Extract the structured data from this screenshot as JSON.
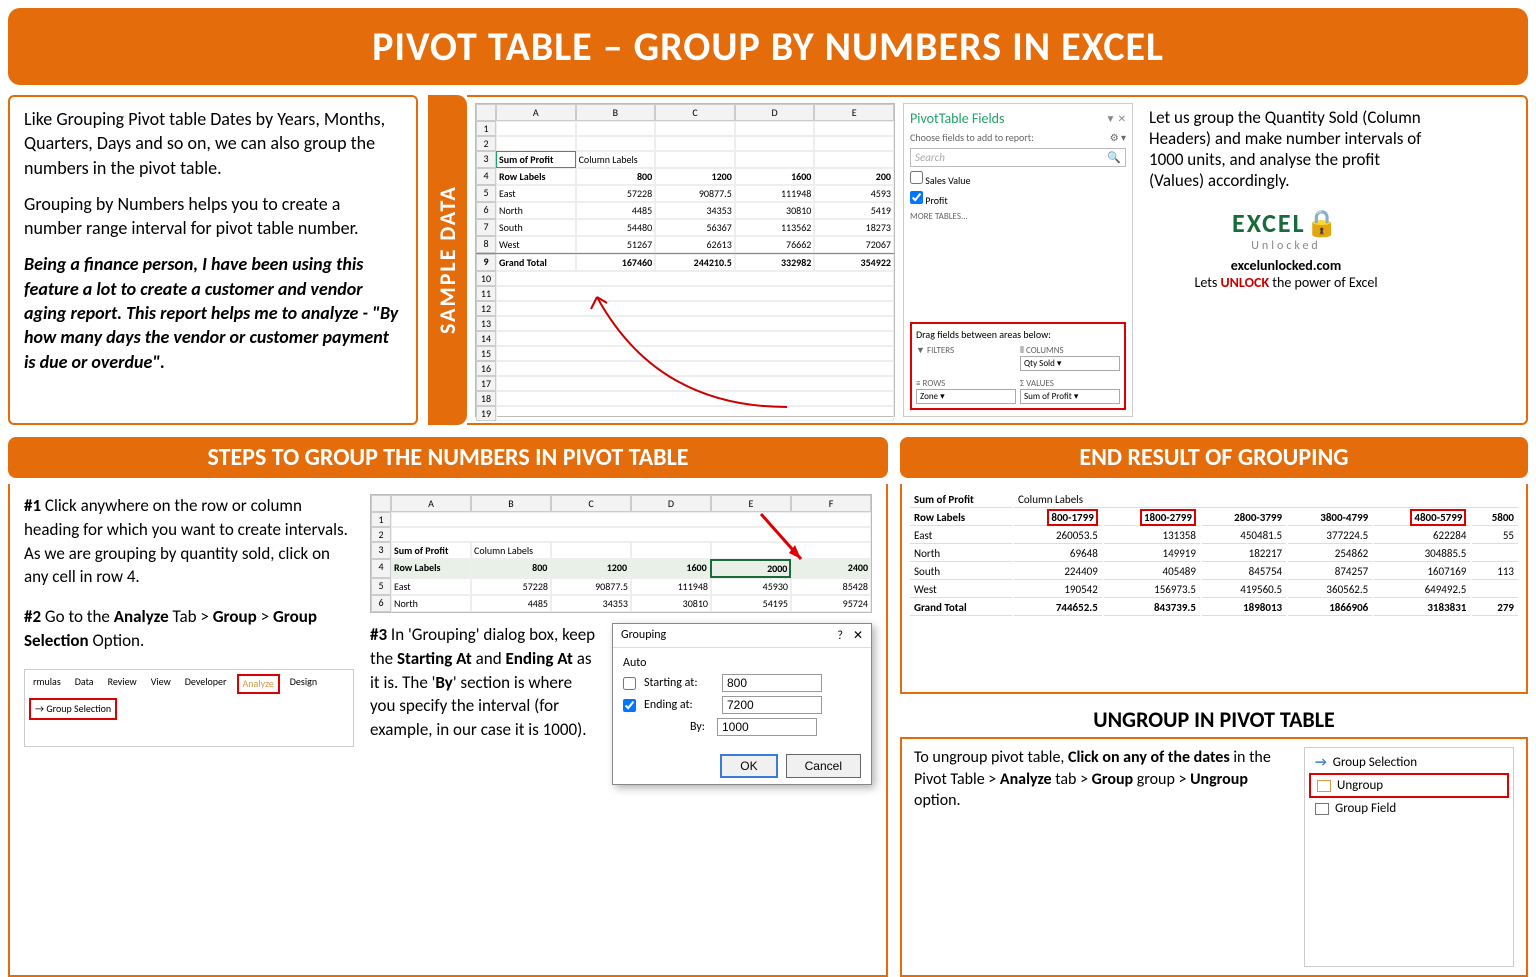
{
  "title": "PIVOT TABLE – GROUP BY NUMBERS IN EXCEL",
  "intro": {
    "p1": "Like Grouping Pivot table Dates by Years, Months, Quarters, Days and so on, we can also group the numbers in the pivot table.",
    "p2": "Grouping by Numbers helps you to create a number range interval for pivot table number.",
    "p3": "Being a finance person, I have been using this feature a lot to create a customer and vendor aging report. This report helps me to analyze - \"By how many days the vendor or customer payment is due or overdue\"."
  },
  "sample_label": "SAMPLE DATA",
  "goal": {
    "text": "Let us group the Quantity Sold (Column Headers) and make number intervals of 1000 units, and analyse the profit (Values) accordingly.",
    "logo_main": "EXCEL",
    "logo_sub": "Unlocked",
    "site": "excelunlocked.com",
    "tag_pre": "Lets ",
    "tag_unlock": "UNLOCK",
    "tag_post": " the power of Excel"
  },
  "ptfields": {
    "title": "PivotTable Fields",
    "subtitle": "Choose fields to add to report:",
    "search": "Search",
    "f1": "Sales Value",
    "f2": "Profit",
    "more": "MORE TABLES...",
    "drag": "Drag fields between areas below:",
    "filters_label": "FILTERS",
    "columns_label": "COLUMNS",
    "columns_field": "Qty Sold",
    "rows_label": "ROWS",
    "rows_field": "Zone",
    "values_label": "VALUES",
    "values_field": "Sum of Profit"
  },
  "sample_grid": {
    "cols": [
      "A",
      "B",
      "C",
      "D",
      "E"
    ],
    "corner": "Sum of Profit",
    "collabel": "Column Labels",
    "rowlabel": "Row Labels",
    "headers": [
      "800",
      "1200",
      "1600",
      "200"
    ],
    "rows": [
      {
        "label": "East",
        "v": [
          "57228",
          "90877.5",
          "111948",
          "4593"
        ]
      },
      {
        "label": "North",
        "v": [
          "4485",
          "34353",
          "30810",
          "5419"
        ]
      },
      {
        "label": "South",
        "v": [
          "54480",
          "56367",
          "113562",
          "18273"
        ]
      },
      {
        "label": "West",
        "v": [
          "51267",
          "62613",
          "76662",
          "72067"
        ]
      },
      {
        "label": "Grand Total",
        "v": [
          "167460",
          "244210.5",
          "332982",
          "354922"
        ]
      }
    ]
  },
  "steps_header": "STEPS TO GROUP THE NUMBERS IN PIVOT TABLE",
  "step1": {
    "num": "#1",
    "text": " Click anywhere on the row or column heading for which you want to create intervals. As we are grouping by quantity sold, click on any cell in row 4."
  },
  "step2": {
    "num": "#2",
    "pre": " Go to the ",
    "analyze": "Analyze",
    "mid": " Tab > ",
    "group": "Group",
    "mid2": " > ",
    "gs": "Group Selection",
    "post": " Option."
  },
  "step3": {
    "num": "#3",
    "pre": " In 'Grouping' dialog box, keep the ",
    "sa": "Starting At",
    "mid": " and ",
    "ea": "Ending At",
    "mid2": " as it is. The '",
    "by": "By",
    "post": "' section is where you specify the interval (for example, in our case it is 1000)."
  },
  "mini_grid": {
    "cols": [
      "A",
      "B",
      "C",
      "D",
      "E",
      "F"
    ],
    "corner": "Sum of Profit",
    "collabel": "Column Labels",
    "rowlabel": "Row Labels",
    "headers": [
      "800",
      "1200",
      "1600",
      "2000",
      "2400"
    ],
    "rows": [
      {
        "label": "East",
        "v": [
          "57228",
          "90877.5",
          "111948",
          "45930",
          "85428"
        ]
      },
      {
        "label": "North",
        "v": [
          "4485",
          "34353",
          "30810",
          "54195",
          "95724"
        ]
      }
    ]
  },
  "ribbon": {
    "tabs": [
      "rmulas",
      "Data",
      "Review",
      "View",
      "Developer",
      "Analyze",
      "Design"
    ],
    "group_selection": "Group Selection"
  },
  "dialog": {
    "title": "Grouping",
    "help": "?",
    "close": "✕",
    "auto": "Auto",
    "starting_label": "Starting at:",
    "starting_val": "800",
    "ending_label": "Ending at:",
    "ending_val": "7200",
    "by_label": "By:",
    "by_val": "1000",
    "ok": "OK",
    "cancel": "Cancel"
  },
  "result_header": "END RESULT OF GROUPING",
  "result": {
    "corner": "Sum of Profit",
    "collabel": "Column Labels",
    "rowlabel": "Row Labels",
    "cols": [
      "800-1799",
      "1800-2799",
      "2800-3799",
      "3800-4799",
      "4800-5799",
      "5800"
    ],
    "rows": [
      {
        "label": "East",
        "v": [
          "260053.5",
          "131358",
          "450481.5",
          "377224.5",
          "622284",
          "55"
        ]
      },
      {
        "label": "North",
        "v": [
          "69648",
          "149919",
          "182217",
          "254862",
          "304885.5",
          ""
        ]
      },
      {
        "label": "South",
        "v": [
          "224409",
          "405489",
          "845754",
          "874257",
          "1607169",
          "113"
        ]
      },
      {
        "label": "West",
        "v": [
          "190542",
          "156973.5",
          "419560.5",
          "360562.5",
          "649492.5",
          ""
        ]
      },
      {
        "label": "Grand Total",
        "v": [
          "744652.5",
          "843739.5",
          "1898013",
          "1866906",
          "3183831",
          "279"
        ]
      }
    ]
  },
  "ungroup": {
    "title": "UNGROUP IN PIVOT TABLE",
    "pre": "To ungroup pivot table, ",
    "b1": "Click on any of the dates",
    "mid1": " in the Pivot Table > ",
    "b2": "Analyze",
    "mid2": " tab > ",
    "b3": "Group",
    "mid3": " group > ",
    "b4": "Ungroup",
    "post": " option.",
    "menu": {
      "gs": "Group Selection",
      "ug": "Ungroup",
      "gf": "Group Field"
    }
  }
}
